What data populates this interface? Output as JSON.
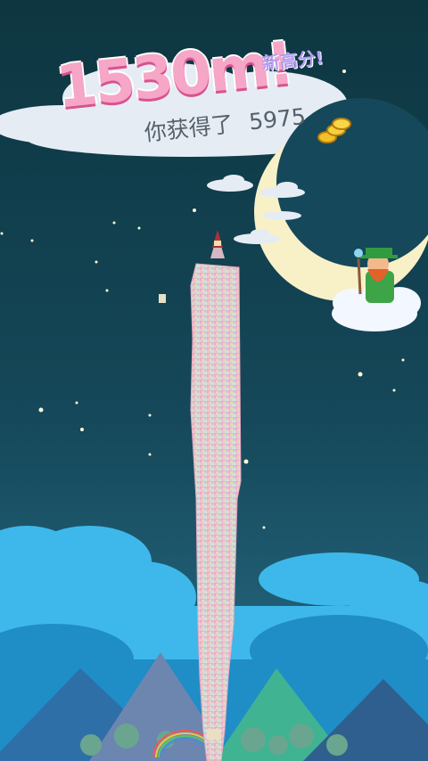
{
  "result": {
    "height_label": "1530m!",
    "new_high_label": "新高分!",
    "earned_prefix": "你获得了",
    "coins_amount": "5975"
  },
  "icons": {
    "coin": "coin-stack-icon",
    "character": "leprechaun-on-cloud",
    "moon": "crescent-moon"
  },
  "colors": {
    "sky_top": "#0d3640",
    "sky_bottom": "#1e7290",
    "score_pink": "#f6a6c6",
    "score_outline": "#d9528f",
    "new_high_purple": "#b59cf0",
    "cloud_blue": "#3eb8ea"
  }
}
